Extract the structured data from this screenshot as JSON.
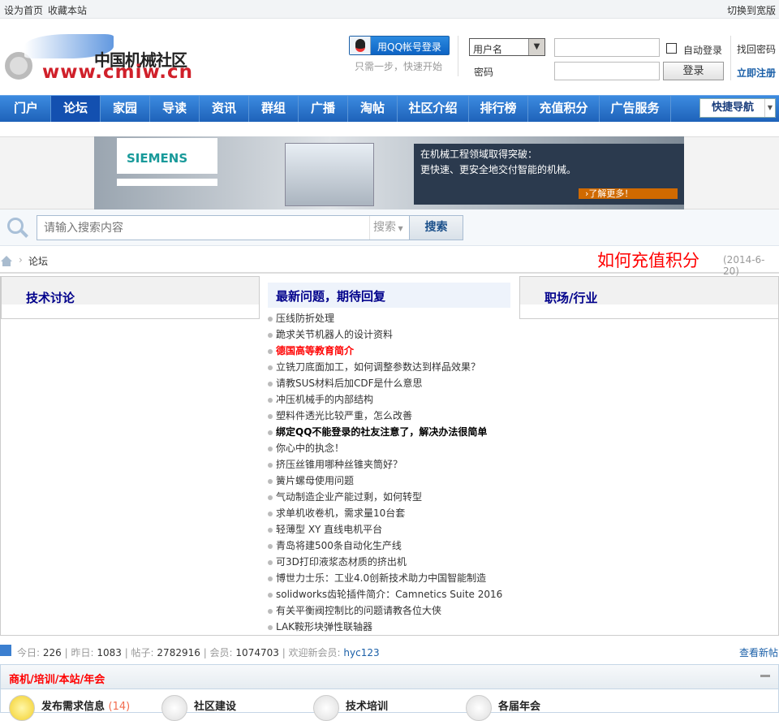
{
  "topbar": {
    "set_home": "设为首页",
    "bookmark": "收藏本站",
    "wide": "切换到宽版"
  },
  "logo": {
    "cn": "中国机械社区",
    "url": "www.cmiw.cn"
  },
  "login": {
    "qq_label": "用QQ帐号登录",
    "qq_hint": "只需一步，快速开始",
    "username_option": "用户名",
    "password_label": "密码",
    "username_value": "",
    "password_value": "",
    "auto_login": "自动登录",
    "login_button": "登录",
    "forgot": "找回密码",
    "register": "立即注册"
  },
  "nav": {
    "items": [
      "门户",
      "论坛",
      "家园",
      "导读",
      "资讯",
      "群组",
      "广播",
      "淘帖",
      "社区介绍",
      "排行榜",
      "充值积分",
      "广告服务"
    ],
    "active": 1,
    "quick": "快捷导航"
  },
  "banner": {
    "brand": "SIEMENS",
    "line1": "在机械工程领域取得突破：",
    "line2": "更快速、更安全地交付智能的机械。",
    "cta": "›了解更多！"
  },
  "search": {
    "placeholder": "请输入搜索内容",
    "type": "搜索",
    "button": "搜索"
  },
  "breadcrumb": {
    "current": "论坛",
    "notice": "如何充值积分",
    "notice_date": "(2014-6-20)"
  },
  "columns": {
    "left": "技术讨论",
    "middle": "最新问题，期待回复",
    "right": "职场/行业"
  },
  "latest": [
    {
      "t": "压线防折处理",
      "s": ""
    },
    {
      "t": "跪求关节机器人的设计资料",
      "s": ""
    },
    {
      "t": "德国高等教育简介",
      "s": "red"
    },
    {
      "t": "立铣刀底面加工，如何调整参数达到样品效果？",
      "s": ""
    },
    {
      "t": "请教SUS材料后加CDF是什么意思",
      "s": ""
    },
    {
      "t": "冲压机械手的内部结构",
      "s": ""
    },
    {
      "t": "塑料件透光比较严重，怎么改善",
      "s": ""
    },
    {
      "t": "绑定QQ不能登录的社友注意了，解决办法很简单",
      "s": "bold"
    },
    {
      "t": "你心中的执念！",
      "s": ""
    },
    {
      "t": "挤压丝锥用哪种丝锥夹筒好？",
      "s": ""
    },
    {
      "t": "簧片螺母使用问题",
      "s": ""
    },
    {
      "t": "气动制造企业产能过剩，如何转型",
      "s": ""
    },
    {
      "t": "求单机收卷机，需求量10台套",
      "s": ""
    },
    {
      "t": "轻薄型 XY 直线电机平台",
      "s": ""
    },
    {
      "t": "青岛将建500条自动化生产线",
      "s": ""
    },
    {
      "t": "可3D打印液浆态材质的挤出机",
      "s": ""
    },
    {
      "t": "博世力士乐：工业4.0创新技术助力中国智能制造",
      "s": ""
    },
    {
      "t": "solidworks齿轮插件简介：Camnetics Suite 2016",
      "s": ""
    },
    {
      "t": "有关平衡阀控制比的问题请教各位大侠",
      "s": ""
    },
    {
      "t": "LAK鞍形块弹性联轴器",
      "s": ""
    }
  ],
  "stats": {
    "today_label": "今日:",
    "today": "226",
    "yesterday_label": "昨日:",
    "yesterday": "1083",
    "posts_label": "帖子:",
    "posts": "2782916",
    "members_label": "会员:",
    "members": "1074703",
    "welcome_label": "欢迎新会员:",
    "newest": "hyc123",
    "view_new": "查看新帖"
  },
  "category": {
    "title": "商机/培训/本站/年会",
    "forums": [
      {
        "name": "发布需求信息",
        "count": "(14)"
      },
      {
        "name": "社区建设",
        "count": ""
      },
      {
        "name": "技术培训",
        "count": ""
      },
      {
        "name": "各届年会",
        "count": ""
      }
    ]
  }
}
